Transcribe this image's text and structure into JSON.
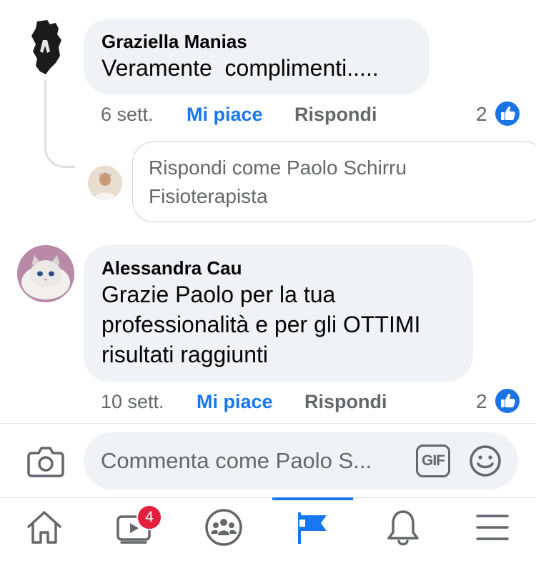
{
  "comments": [
    {
      "author": "Graziella Manias",
      "text": "Veramente  complimenti.....",
      "time": "6 sett.",
      "like_label": "Mi piace",
      "reply_label": "Rispondi",
      "reaction_count": "2"
    },
    {
      "author": "Alessandra Cau",
      "text": "Grazie Paolo per la tua\nprofessionalità e per gli OTTIMI\nrisultati raggiunti",
      "time": "10 sett.",
      "like_label": "Mi piace",
      "reply_label": "Rispondi",
      "reaction_count": "2"
    }
  ],
  "reply_box": {
    "placeholder": "Rispondi come Paolo Schirru Fisioterapista"
  },
  "composer": {
    "placeholder": "Commenta come Paolo S...",
    "gif_label": "GIF"
  },
  "tabbar": {
    "items": [
      {
        "icon": "home-icon"
      },
      {
        "icon": "video-icon",
        "badge": "4"
      },
      {
        "icon": "groups-icon"
      },
      {
        "icon": "pages-flag-icon",
        "active": true
      },
      {
        "icon": "notifications-bell-icon"
      },
      {
        "icon": "menu-icon"
      }
    ]
  },
  "colors": {
    "accent": "#1877f2",
    "bubble": "#f0f2f5",
    "secondary_text": "#65676b",
    "badge": "#e41e3f"
  }
}
